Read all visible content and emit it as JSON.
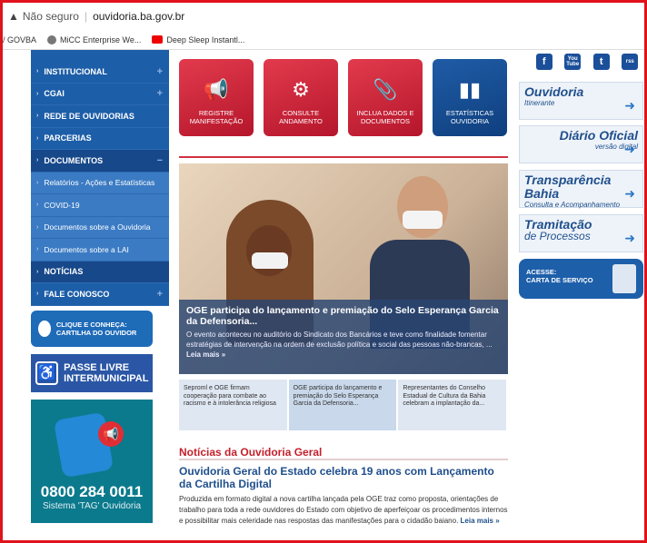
{
  "browser": {
    "security": "Não seguro",
    "url": "ouvidoria.ba.gov.br"
  },
  "bookmarks": [
    "/ GOVBA",
    "MiCC Enterprise We...",
    "Deep Sleep Instantl..."
  ],
  "nav": {
    "items": [
      {
        "label": "INSTITUCIONAL",
        "plus": "+"
      },
      {
        "label": "CGAI",
        "plus": "+"
      },
      {
        "label": "REDE DE OUVIDORIAS",
        "plus": ""
      },
      {
        "label": "PARCERIAS",
        "plus": ""
      },
      {
        "label": "DOCUMENTOS",
        "plus": "−"
      },
      {
        "label": "Relatórios - Ações e Estatísticas",
        "plus": ""
      },
      {
        "label": "COVID-19",
        "plus": ""
      },
      {
        "label": "Documentos sobre a Ouvidoria",
        "plus": ""
      },
      {
        "label": "Documentos sobre a LAI",
        "plus": ""
      },
      {
        "label": "NOTÍCIAS",
        "plus": ""
      },
      {
        "label": "FALE CONOSCO",
        "plus": "+"
      }
    ]
  },
  "promos": {
    "cartilha": "CLIQUE E CONHEÇA: CARTILHA DO OUVIDOR",
    "passe": "PASSE LIVRE INTERMUNICIPAL",
    "phone_number": "0800 284 0011",
    "phone_sub": "Sistema 'TAG' Ouvidoria"
  },
  "tiles": [
    {
      "label": "REGISTRE MANIFESTAÇÃO",
      "icon": "megaphone-icon",
      "glyph": "📢"
    },
    {
      "label": "CONSULTE ANDAMENTO",
      "icon": "document-gear-icon",
      "glyph": "⚙"
    },
    {
      "label": "INCLUA DADOS E DOCUMENTOS",
      "icon": "paperclip-icon",
      "glyph": "📎"
    },
    {
      "label": "ESTATÍSTICAS OUVIDORIA",
      "icon": "bar-chart-icon",
      "glyph": "▮▮"
    }
  ],
  "featured": {
    "title": "OGE participa do lançamento e premiação do Selo Esperança Garcia da Defensoria...",
    "desc": "O evento aconteceu no auditório do Sindicato dos Bancários e teve como finalidade fomentar estratégias de intervenção na ordem de exclusão política e social das pessoas não-brancas, ...",
    "more": "Leia mais »"
  },
  "thumbs": [
    "Seproml e OGE firmam cooperação para combate ao racismo e à intolerância religiosa",
    "OGE participa do lançamento e premiação do Selo Esperança Garcia da Defensoria...",
    "Representantes do Conselho Estadual de Cultura da Bahia celebram a implantação da..."
  ],
  "news": {
    "section": "Notícias da Ouvidoria Geral",
    "title": "Ouvidoria Geral do Estado celebra 19 anos com Lançamento da Cartilha Digital",
    "desc": "Produzida em formato digital a nova cartilha lançada pela OGE traz como proposta, orientações de trabalho para toda a rede ouvidores do Estado com objetivo de aperfeiçoar os procedimentos internos e possibilitar mais celeridade nas respostas das manifestações para o cidadão baiano.",
    "more": "Leia mais »"
  },
  "social": [
    "f",
    "You Tube",
    "t",
    "rss"
  ],
  "banners": [
    {
      "title": "Ouvidoria",
      "sub": "Itinerante"
    },
    {
      "title": "Diário Oficial",
      "sub": "versão digital"
    },
    {
      "title": "Transparência Bahia",
      "sub": "Consulta e Acompanhamento"
    },
    {
      "title": "Tramitação",
      "sub": "de Processos"
    }
  ],
  "acesse": {
    "line1": "ACESSE:",
    "line2": "CARTA DE SERVIÇO"
  }
}
